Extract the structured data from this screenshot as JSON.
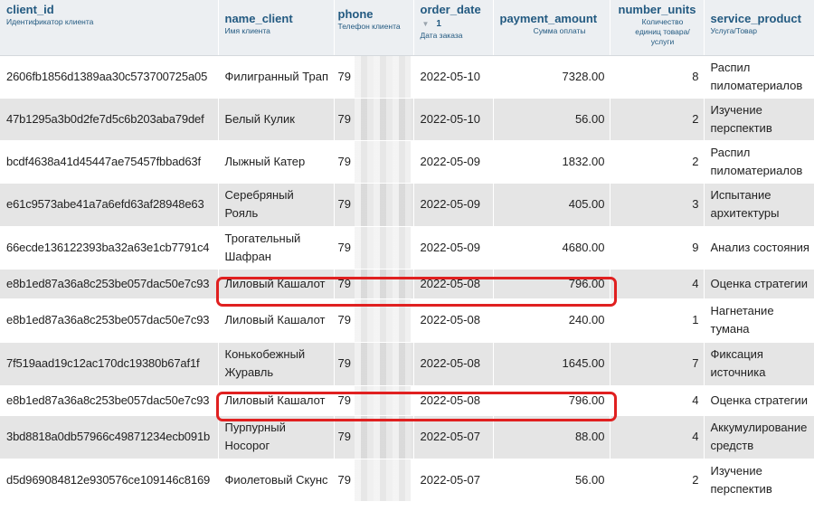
{
  "columns": [
    {
      "name": "client_id",
      "desc": "Идентификатор клиента"
    },
    {
      "name": "name_client",
      "desc": "Имя клиента"
    },
    {
      "name": "phone",
      "desc": "Телефон клиента"
    },
    {
      "name": "order_date",
      "sort_index": "1",
      "desc": "Дата заказа"
    },
    {
      "name": "payment_amount",
      "desc": "Сумма оплаты"
    },
    {
      "name": "number_units",
      "desc": "Количество единиц товара/ услуги"
    },
    {
      "name": "service_product",
      "desc": "Услуга/Товар"
    }
  ],
  "rows": [
    {
      "client_id": "2606fb1856d1389aa30c573700725a05",
      "name_client": "Филигранный Трап",
      "phone": "79",
      "order_date": "2022-05-10",
      "payment_amount": "7328.00",
      "number_units": "8",
      "service_product": "Распил пиломатериалов"
    },
    {
      "client_id": "47b1295a3b0d2fe7d5c6b203aba79def",
      "name_client": "Белый Кулик",
      "phone": "79",
      "order_date": "2022-05-10",
      "payment_amount": "56.00",
      "number_units": "2",
      "service_product": "Изучение перспектив"
    },
    {
      "client_id": "bcdf4638a41d45447ae75457fbbad63f",
      "name_client": "Лыжный Катер",
      "phone": "79",
      "order_date": "2022-05-09",
      "payment_amount": "1832.00",
      "number_units": "2",
      "service_product": "Распил пиломатериалов"
    },
    {
      "client_id": "e61c9573abe41a7a6efd63af28948e63",
      "name_client": "Серебряный Рояль",
      "phone": "79",
      "order_date": "2022-05-09",
      "payment_amount": "405.00",
      "number_units": "3",
      "service_product": "Испытание архитектуры"
    },
    {
      "client_id": "66ecde136122393ba32a63e1cb7791c4",
      "name_client": "Трогательный Шафран",
      "phone": "79",
      "order_date": "2022-05-09",
      "payment_amount": "4680.00",
      "number_units": "9",
      "service_product": "Анализ состояния"
    },
    {
      "client_id": "e8b1ed87a36a8c253be057dac50e7c93",
      "name_client": "Лиловый Кашалот",
      "phone": "79",
      "order_date": "2022-05-08",
      "payment_amount": "796.00",
      "number_units": "4",
      "service_product": "Оценка стратегии"
    },
    {
      "client_id": "e8b1ed87a36a8c253be057dac50e7c93",
      "name_client": "Лиловый Кашалот",
      "phone": "79",
      "order_date": "2022-05-08",
      "payment_amount": "240.00",
      "number_units": "1",
      "service_product": "Нагнетание тумана"
    },
    {
      "client_id": "7f519aad19c12ac170dc19380b67af1f",
      "name_client": "Конькобежный Журавль",
      "phone": "79",
      "order_date": "2022-05-08",
      "payment_amount": "1645.00",
      "number_units": "7",
      "service_product": "Фиксация источника"
    },
    {
      "client_id": "e8b1ed87a36a8c253be057dac50e7c93",
      "name_client": "Лиловый Кашалот",
      "phone": "79",
      "order_date": "2022-05-08",
      "payment_amount": "796.00",
      "number_units": "4",
      "service_product": "Оценка стратегии"
    },
    {
      "client_id": "3bd8818a0db57966c49871234ecb091b",
      "name_client": "Пурпурный Носорог",
      "phone": "79",
      "order_date": "2022-05-07",
      "payment_amount": "88.00",
      "number_units": "4",
      "service_product": "Аккумулирование средств"
    },
    {
      "client_id": "d5d969084812e930576ce109146c8169",
      "name_client": "Фиолетовый Скунс",
      "phone": "79",
      "order_date": "2022-05-07",
      "payment_amount": "56.00",
      "number_units": "2",
      "service_product": "Изучение перспектив"
    }
  ],
  "colors": {
    "header_bg": "#eceff2",
    "header_text": "#235a81",
    "row_alt": "#e5e5e5",
    "highlight": "#e02020"
  }
}
